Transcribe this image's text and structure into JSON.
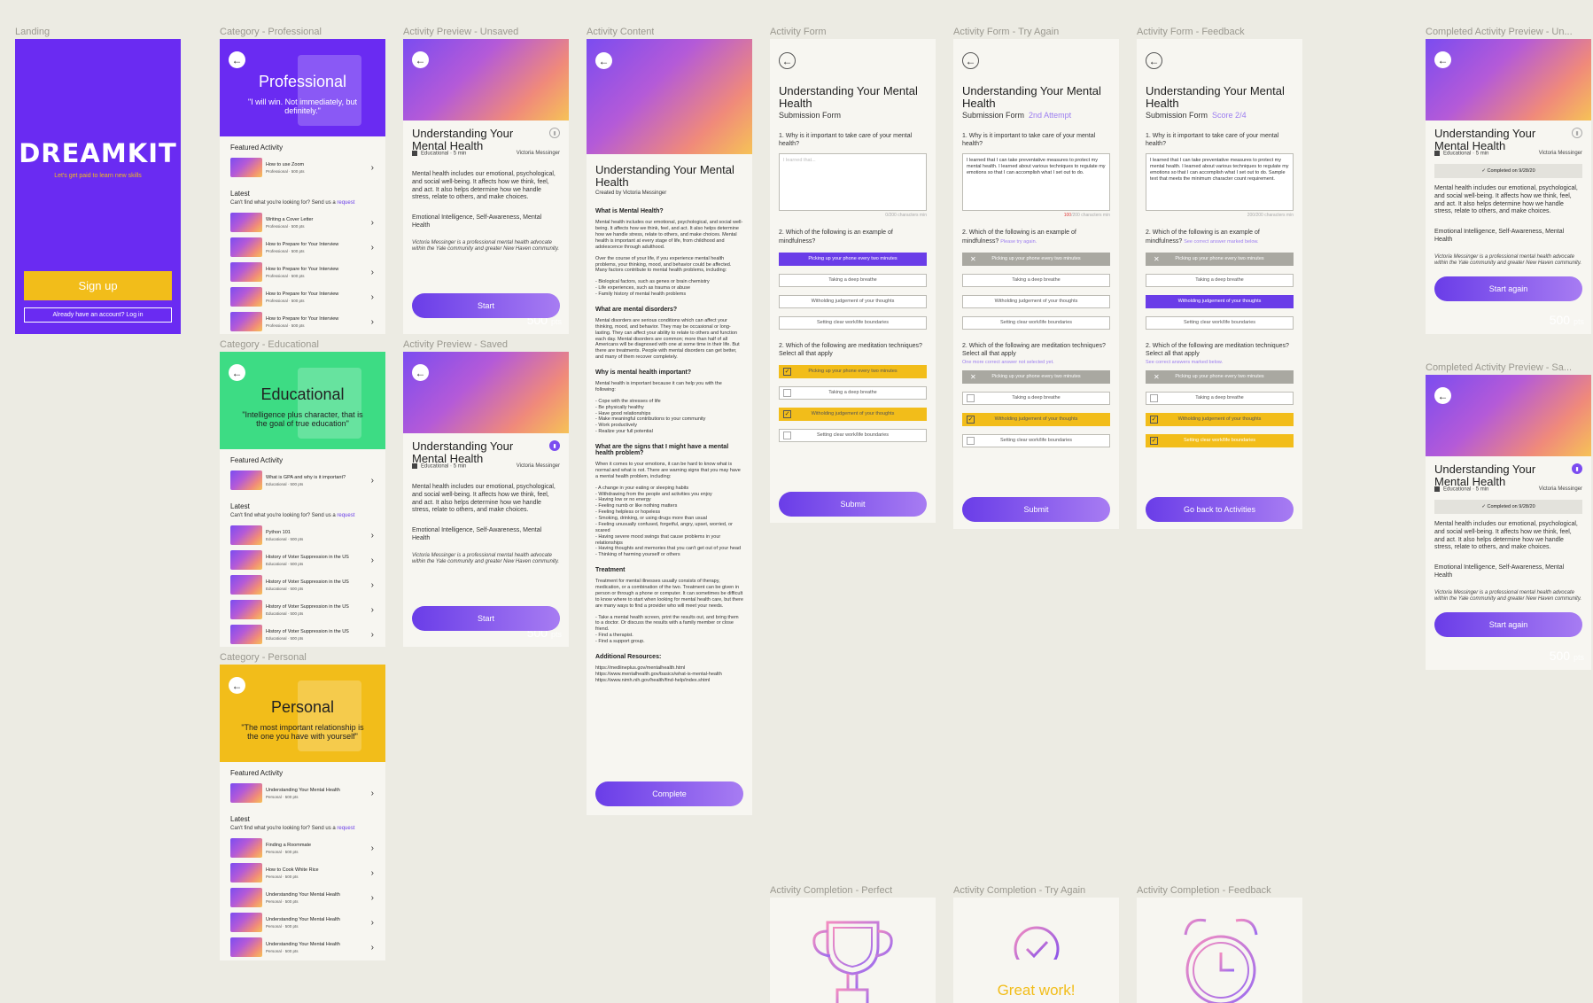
{
  "colors": {
    "purple": "#6a3de8",
    "yellow": "#f2bd1a",
    "green": "#3ddc84",
    "bg": "#ecebe3"
  },
  "labels": {
    "landing": "Landing",
    "cat_pro": "Category - Professional",
    "cat_edu": "Category - Educational",
    "cat_per": "Category - Personal",
    "prev_unsaved": "Activity Preview - Unsaved",
    "prev_saved": "Activity Preview - Saved",
    "content": "Activity Content",
    "form": "Activity Form",
    "form_try": "Activity Form - Try Again",
    "form_fb": "Activity Form - Feedback",
    "comp_un": "Completed Activity Preview - Un...",
    "comp_sa": "Completed Activity Preview - Sa...",
    "done_perfect": "Activity Completion - Perfect",
    "done_try": "Activity Completion - Try Again",
    "done_fb": "Activity Completion - Feedback"
  },
  "landing": {
    "logo": "DREAMKIT",
    "tagline": "Let's get paid to learn new skills",
    "signup": "Sign up",
    "login": "Already have an account? Log in"
  },
  "common": {
    "featured": "Featured Activity",
    "latest": "Latest",
    "cant_find": "Can't find what you're looking for? Send us a ",
    "request": "request"
  },
  "cat_pro": {
    "title": "Professional",
    "quote": "\"I will win. Not immediately, but definitely.\"",
    "featured": {
      "title": "How to use Zoom",
      "meta": "Professional · 500 pts"
    },
    "items": [
      {
        "title": "Writing a Cover Letter",
        "meta": "Professional · 500 pts"
      },
      {
        "title": "How to Prepare for Your Interview",
        "meta": "Professional · 500 pts"
      },
      {
        "title": "How to Prepare for Your Interview",
        "meta": "Professional · 500 pts"
      },
      {
        "title": "How to Prepare for Your Interview",
        "meta": "Professional · 500 pts"
      },
      {
        "title": "How to Prepare for Your Interview",
        "meta": "Professional · 500 pts"
      }
    ]
  },
  "cat_edu": {
    "title": "Educational",
    "quote": "\"Intelligence plus character, that is the goal of true education\"",
    "featured": {
      "title": "What is GPA and why is it important?",
      "meta": "Educational · 500 pts"
    },
    "items": [
      {
        "title": "Python 101",
        "meta": "Educational · 500 pts"
      },
      {
        "title": "History of Voter Suppression in the US",
        "meta": "Educational · 500 pts"
      },
      {
        "title": "History of Voter Suppression in the US",
        "meta": "Educational · 500 pts"
      },
      {
        "title": "History of Voter Suppression in the US",
        "meta": "Educational · 500 pts"
      },
      {
        "title": "History of Voter Suppression in the US",
        "meta": "Educational · 500 pts"
      }
    ]
  },
  "cat_per": {
    "title": "Personal",
    "quote": "\"The most important relationship is the one you have with yourself\"",
    "featured": {
      "title": "Understanding Your Mental Health",
      "meta": "Personal · 500 pts"
    },
    "items": [
      {
        "title": "Finding a Roommate",
        "meta": "Personal · 500 pts"
      },
      {
        "title": "How to Cook White Rice",
        "meta": "Personal · 500 pts"
      },
      {
        "title": "Understanding Your Mental Health",
        "meta": "Personal · 500 pts"
      },
      {
        "title": "Understanding Your Mental Health",
        "meta": "Personal · 500 pts"
      },
      {
        "title": "Understanding Your Mental Health",
        "meta": "Personal · 500 pts"
      }
    ]
  },
  "activity": {
    "pts": "500",
    "pts_unit": "pts",
    "title": "Understanding Your Mental Health",
    "category": "Educational · 5 min",
    "author": "Victoria Messinger",
    "desc": "Mental health includes our emotional, psychological, and social well-being. It affects how we think, feel, and act. It also helps determine how we handle stress, relate to others, and make choices.",
    "skills": "Emotional Intelligence, Self-Awareness, Mental Health",
    "bio": "Victoria Messinger is a professional mental health advocate within the Yale community and greater New Haven community.",
    "start": "Start",
    "start_again": "Start again",
    "completed": "Completed on 9/28/20"
  },
  "content": {
    "title": "Understanding Your Mental Health",
    "created": "Created by Victoria Messinger",
    "h1": "What is Mental Health?",
    "p1": "Mental health includes our emotional, psychological, and social well-being. It affects how we think, feel, and act. It also helps determine how we handle stress, relate to others, and make choices. Mental health is important at every stage of life, from childhood and adolescence through adulthood.",
    "p2": "Over the course of your life, if you experience mental health problems, your thinking, mood, and behavior could be affected. Many factors contribute to mental health problems, including:",
    "l2": "- Biological factors, such as genes or brain chemistry\n- Life experiences, such as trauma or abuse\n- Family history of mental health problems",
    "h2": "What are mental disorders?",
    "p3": "Mental disorders are serious conditions which can affect your thinking, mood, and behavior. They may be occasional or long-lasting. They can affect your ability to relate to others and function each day. Mental disorders are common; more than half of all Americans will be diagnosed with one at some time in their life. But there are treatments. People with mental disorders can get better, and many of them recover completely.",
    "h3": "Why is mental health important?",
    "p4": "Mental health is important because it can help you with the following:",
    "l4": "- Cope with the stresses of life\n- Be physically healthy\n- Have good relationships\n- Make meaningful contributions to your community\n- Work productively\n- Realize your full potential",
    "h4": "What are the signs that I might have a mental health problem?",
    "p5": "When it comes to your emotions, it can be hard to know what is normal and what is not. There are warning signs that you may have a mental health problem, including:",
    "l5": "- A change in your eating or sleeping habits\n- Withdrawing from the people and activities you enjoy\n- Having low or no energy\n- Feeling numb or like nothing matters\n- Feeling helpless or hopeless\n- Smoking, drinking, or using drugs more than usual\n- Feeling unusually confused, forgetful, angry, upset, worried, or scared\n- Having severe mood swings that cause problems in your relationships\n- Having thoughts and memories that you can't get out of your head\n- Thinking of harming yourself or others",
    "h5": "Treatment",
    "p6": "Treatment for mental illnesses usually consists of therapy, medication, or a combination of the two. Treatment can be given in person or through a phone or computer. It can sometimes be difficult to know where to start when looking for mental health care, but there are many ways to find a provider who will meet your needs.",
    "l6": "- Take a mental health screen, print the results out, and bring them to a doctor. Or discuss the results with a family member or close friend.\n- Find a therapist.\n- Find a support group.",
    "h6": "Additional Resources:",
    "links": "https://medlineplus.gov/mentalhealth.html\nhttps://www.mentalhealth.gov/basics/what-is-mental-health\nhttps://www.nimh.nih.gov/health/find-help/index.shtml",
    "complete": "Complete"
  },
  "form": {
    "title": "Understanding Your Mental Health",
    "sub": "Submission Form",
    "attempt": "2nd Attempt",
    "score": "Score 2/4",
    "q1": "1. Why is it important to take care of your mental health?",
    "q1_placeholder": "I learned that...",
    "q1_answer": "I learned that I can take preventative measures to protect my mental health. I learned about various techniques to regulate my emotions so that I can accomplish what I set out to do.",
    "q1_answer_long": "I learned that I can take preventative measures to protect my mental health. I learned about various techniques to regulate my emotions so that I can accomplish what I set out to do. Sample text that meets the minimum character count requirement.",
    "cnt0": "0/200 characters min",
    "cnt_try_red": "100",
    "cnt_try": "/200 characters min",
    "cnt_fb": "200/200 characters min",
    "q2": "2. Which of the following is an example of mindfulness?",
    "q2_hint_try": "Please try again.",
    "q2_hint_fb": "See correct answer marked below.",
    "q3": "2. Which of the following are meditation techniques? Select all that apply",
    "q3_hint_try": "One more correct answer not selected yet.",
    "q3_hint_fb": "See correct answers marked below.",
    "o1": "Picking up your phone every two minutes",
    "o2": "Taking a deep breathe",
    "o3": "Witholding judgement of your thoughts",
    "o4": "Setting clear work/life boundaries",
    "submit": "Submit",
    "go_back": "Go back to Activities"
  },
  "completion": {
    "great": "Great work!"
  }
}
